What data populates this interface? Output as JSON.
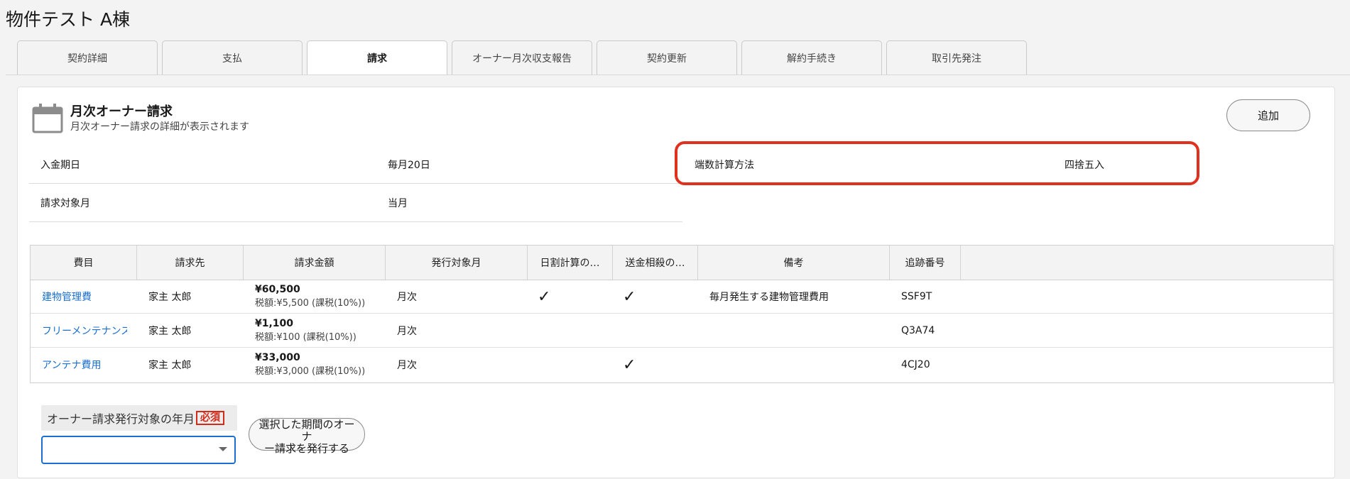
{
  "page": {
    "title": "物件テスト A棟"
  },
  "tabs": [
    {
      "label": "契約詳細"
    },
    {
      "label": "支払"
    },
    {
      "label": "請求",
      "active": true
    },
    {
      "label": "オーナー月次収支報告"
    },
    {
      "label": "契約更新"
    },
    {
      "label": "解約手続き"
    },
    {
      "label": "取引先発注"
    }
  ],
  "card": {
    "icon": "calendar-icon",
    "title": "月次オーナー請求",
    "subtitle": "月次オーナー請求の詳細が表示されます",
    "add_label": "追加"
  },
  "fields": {
    "payment_due": {
      "label": "入金期日",
      "value": "毎月20日"
    },
    "billing_month": {
      "label": "請求対象月",
      "value": "当月"
    },
    "rounding": {
      "label": "端数計算方法",
      "value": "四捨五入"
    }
  },
  "table": {
    "headers": [
      "費目",
      "請求先",
      "請求金額",
      "発行対象月",
      "日割計算の…",
      "送金相殺の…",
      "備考",
      "追跡番号"
    ],
    "rows": [
      {
        "item": "建物管理費",
        "payee": "家主 太郎",
        "amount": "¥60,500",
        "tax": "税額:¥5,500 (課税(10%))",
        "month": "月次",
        "prorate": "✓",
        "offset": "✓",
        "note": "毎月発生する建物管理費用",
        "tracking": "SSF9T"
      },
      {
        "item": "フリーメンテナンス",
        "payee": "家主 太郎",
        "amount": "¥1,100",
        "tax": "税額:¥100 (課税(10%))",
        "month": "月次",
        "prorate": "",
        "offset": "",
        "note": "",
        "tracking": "Q3A74"
      },
      {
        "item": "アンテナ費用",
        "payee": "家主 太郎",
        "amount": "¥33,000",
        "tax": "税額:¥3,000 (課税(10%))",
        "month": "月次",
        "prorate": "",
        "offset": "✓",
        "note": "",
        "tracking": "4CJ20"
      }
    ]
  },
  "issue": {
    "label": "オーナー請求発行対象の年月",
    "required": "必須",
    "select_value": "",
    "button_line1": "選択した期間のオーナ",
    "button_line2": "ー請求を発行する"
  },
  "colors": {
    "link": "#1a6fd0",
    "highlight": "#e0301e",
    "required": "#d42a1a"
  }
}
